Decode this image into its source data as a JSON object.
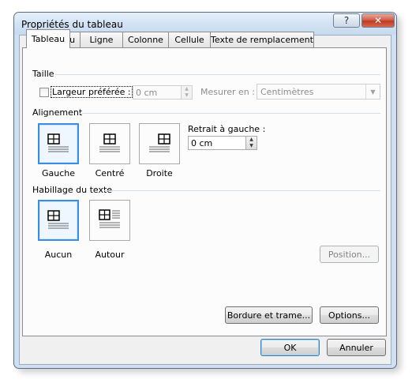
{
  "window": {
    "title": "Propriétés du tableau",
    "help_glyph": "?",
    "close_glyph": "✕"
  },
  "tabs": [
    {
      "label": "Tableau",
      "active": true
    },
    {
      "label": "Ligne",
      "active": false
    },
    {
      "label": "Colonne",
      "active": false
    },
    {
      "label": "Cellule",
      "active": false
    },
    {
      "label": "Texte de remplacement",
      "active": false
    }
  ],
  "size_group": {
    "label": "Taille",
    "preferred_width_label": "Largeur préférée :",
    "preferred_width_checked": false,
    "preferred_width_value": "0 cm",
    "measure_in_label": "Mesurer en :",
    "measure_in_value": "Centimètres"
  },
  "alignment_group": {
    "label": "Alignement",
    "options": [
      {
        "label": "Gauche",
        "selected": true
      },
      {
        "label": "Centré",
        "selected": false
      },
      {
        "label": "Droite",
        "selected": false
      }
    ],
    "indent_label": "Retrait à gauche :",
    "indent_value": "0 cm"
  },
  "wrapping_group": {
    "label": "Habillage du texte",
    "options": [
      {
        "label": "Aucun",
        "selected": true
      },
      {
        "label": "Autour",
        "selected": false
      }
    ],
    "position_button": "Position..."
  },
  "buttons": {
    "borders": "Bordure et trame...",
    "options": "Options...",
    "ok": "OK",
    "cancel": "Annuler"
  },
  "colors": {
    "frame": "#cfe0f3",
    "selection_accent": "#3c8de0",
    "close_red": "#c03a21"
  },
  "icons": {
    "table_glyph": "table-icon",
    "spin_up": "▲",
    "spin_down": "▼",
    "dropdown": "▼"
  }
}
